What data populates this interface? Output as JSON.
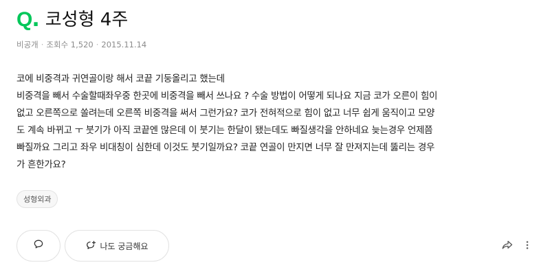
{
  "question": {
    "q_mark": "Q",
    "q_dot": ".",
    "title": "코성형 4주",
    "meta": {
      "visibility": "비공개",
      "separator": "·",
      "views": "조회수 1,520",
      "date": "2015.11.14"
    },
    "body_lines": [
      "코에 비중격과 귀연골이랑 해서 코끝 기둥올리고 했는데",
      "비중격을 빼서 수술할때좌우중 한곳에 비중격을 빼서 쓰나요 ? 수술 방법이 어떻게 되나요 지금 코가 오른이 힘이",
      "없고 오른쪽으로 쏠려는데 오른쪽 비중격을 써서 그런가요? 코가 전혀적으로 힘이 없고 너무 쉽게 움직이고 모양",
      "도 계속 바뀌고 ㅜ 붓기가 아직 코끝엔 많은데 이 붓기는 한달이 됐는데도 빠질생각을 안하네요 늦는경우 언제쯤",
      "빠질까요 그리고 좌우 비대칭이 심한데 이것도 붓기일까요? 코끝 연골이 만지면 너무 잘 만져지는데 뚫리는 경우",
      "가 흔한가요?"
    ],
    "tag": "성형외과"
  },
  "actions": {
    "curious_label": "나도 궁금해요",
    "icons": {
      "comment": "comment-icon",
      "curious": "question-bubble-icon",
      "share": "share-icon",
      "more": "more-vertical-icon"
    }
  },
  "colors": {
    "accent": "#03c75a",
    "text": "#222222",
    "meta": "#8c8c8c"
  }
}
